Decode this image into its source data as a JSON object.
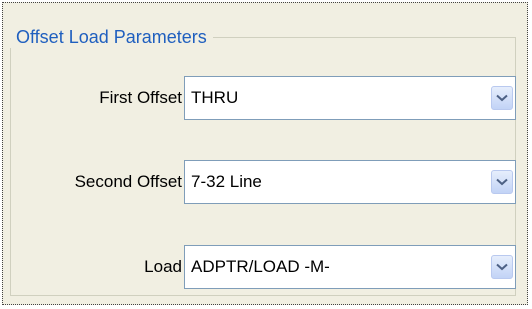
{
  "group": {
    "title": "Offset Load Parameters"
  },
  "fields": [
    {
      "label": "First Offset",
      "value": "THRU"
    },
    {
      "label": "Second Offset",
      "value": "7-32 Line"
    },
    {
      "label": "Load",
      "value": "ADPTR/LOAD -M-"
    }
  ],
  "colors": {
    "panel_bg": "#f1efe2",
    "title": "#1f5fbf",
    "combo_border": "#7f9db9",
    "dropdown_button": "#c2d3f6"
  },
  "icons": {
    "dropdown": "chevron-down-icon"
  }
}
